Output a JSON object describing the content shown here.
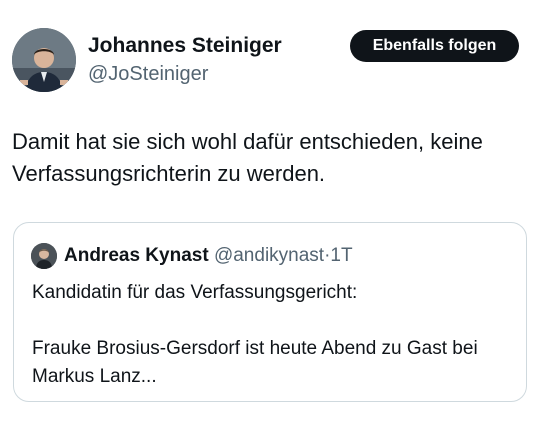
{
  "tweet": {
    "author_name": "Johannes Steiniger",
    "author_handle": "@JoSteiniger",
    "follow_label": "Ebenfalls folgen",
    "text": "Damit hat sie sich wohl dafür entschieden, keine Verfassungsrichterin zu werden.",
    "avatar": "profile-photo-man-speaking-at-podium"
  },
  "quoted_tweet": {
    "author_name": "Andreas Kynast",
    "author_handle": "@andikynast",
    "separator": "·",
    "time": "1T",
    "avatar": "profile-photo-man",
    "text_line_1": "Kandidatin für das Verfassungsgericht:",
    "text_line_2": "Frauke Brosius-Gersdorf ist heute Abend zu Gast bei Markus Lanz..."
  },
  "colors": {
    "text": "#0f1419",
    "secondary": "#536471",
    "border": "#cfd9de",
    "button_bg": "#0f1419",
    "button_text": "#ffffff"
  }
}
